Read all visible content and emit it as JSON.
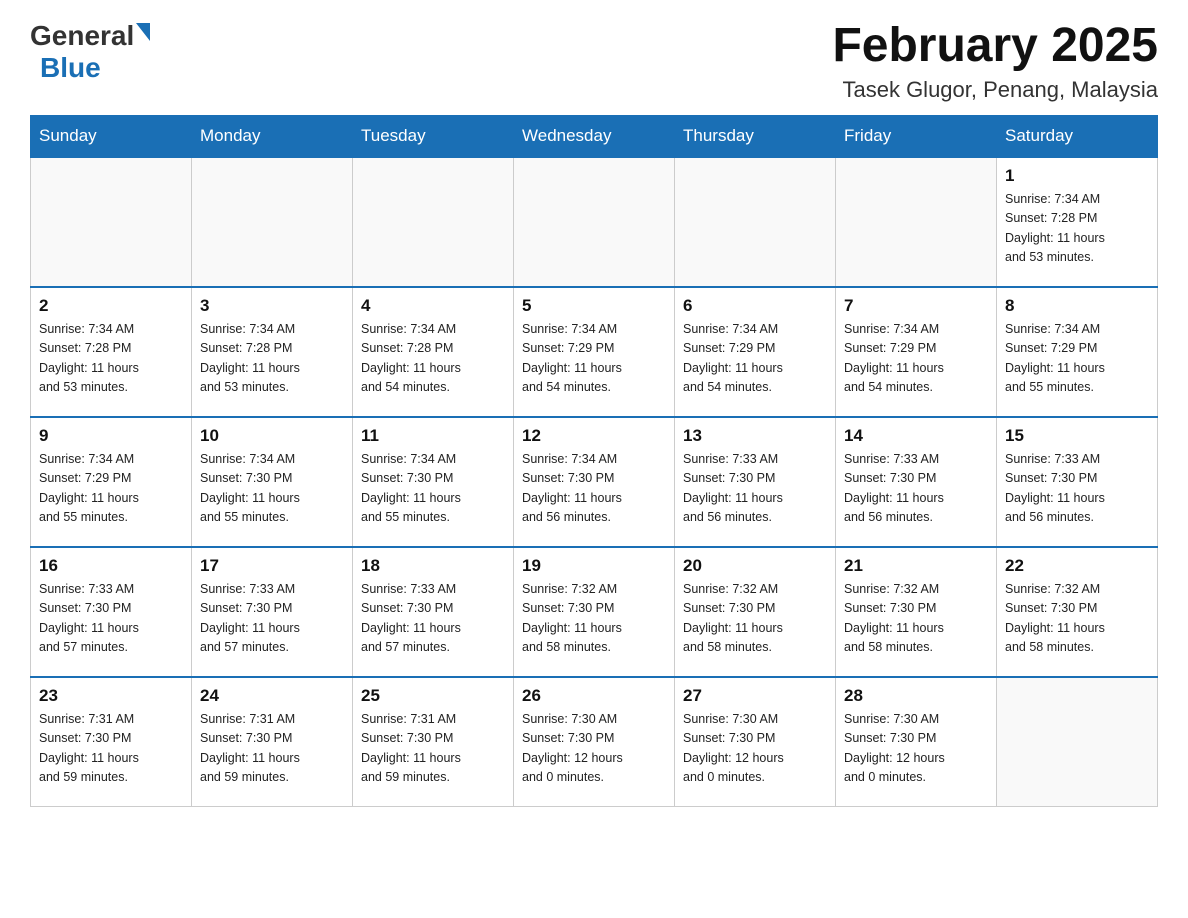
{
  "header": {
    "logo_general": "General",
    "logo_blue": "Blue",
    "title": "February 2025",
    "subtitle": "Tasek Glugor, Penang, Malaysia"
  },
  "weekdays": [
    "Sunday",
    "Monday",
    "Tuesday",
    "Wednesday",
    "Thursday",
    "Friday",
    "Saturday"
  ],
  "weeks": [
    [
      {
        "day": "",
        "info": ""
      },
      {
        "day": "",
        "info": ""
      },
      {
        "day": "",
        "info": ""
      },
      {
        "day": "",
        "info": ""
      },
      {
        "day": "",
        "info": ""
      },
      {
        "day": "",
        "info": ""
      },
      {
        "day": "1",
        "info": "Sunrise: 7:34 AM\nSunset: 7:28 PM\nDaylight: 11 hours\nand 53 minutes."
      }
    ],
    [
      {
        "day": "2",
        "info": "Sunrise: 7:34 AM\nSunset: 7:28 PM\nDaylight: 11 hours\nand 53 minutes."
      },
      {
        "day": "3",
        "info": "Sunrise: 7:34 AM\nSunset: 7:28 PM\nDaylight: 11 hours\nand 53 minutes."
      },
      {
        "day": "4",
        "info": "Sunrise: 7:34 AM\nSunset: 7:28 PM\nDaylight: 11 hours\nand 54 minutes."
      },
      {
        "day": "5",
        "info": "Sunrise: 7:34 AM\nSunset: 7:29 PM\nDaylight: 11 hours\nand 54 minutes."
      },
      {
        "day": "6",
        "info": "Sunrise: 7:34 AM\nSunset: 7:29 PM\nDaylight: 11 hours\nand 54 minutes."
      },
      {
        "day": "7",
        "info": "Sunrise: 7:34 AM\nSunset: 7:29 PM\nDaylight: 11 hours\nand 54 minutes."
      },
      {
        "day": "8",
        "info": "Sunrise: 7:34 AM\nSunset: 7:29 PM\nDaylight: 11 hours\nand 55 minutes."
      }
    ],
    [
      {
        "day": "9",
        "info": "Sunrise: 7:34 AM\nSunset: 7:29 PM\nDaylight: 11 hours\nand 55 minutes."
      },
      {
        "day": "10",
        "info": "Sunrise: 7:34 AM\nSunset: 7:30 PM\nDaylight: 11 hours\nand 55 minutes."
      },
      {
        "day": "11",
        "info": "Sunrise: 7:34 AM\nSunset: 7:30 PM\nDaylight: 11 hours\nand 55 minutes."
      },
      {
        "day": "12",
        "info": "Sunrise: 7:34 AM\nSunset: 7:30 PM\nDaylight: 11 hours\nand 56 minutes."
      },
      {
        "day": "13",
        "info": "Sunrise: 7:33 AM\nSunset: 7:30 PM\nDaylight: 11 hours\nand 56 minutes."
      },
      {
        "day": "14",
        "info": "Sunrise: 7:33 AM\nSunset: 7:30 PM\nDaylight: 11 hours\nand 56 minutes."
      },
      {
        "day": "15",
        "info": "Sunrise: 7:33 AM\nSunset: 7:30 PM\nDaylight: 11 hours\nand 56 minutes."
      }
    ],
    [
      {
        "day": "16",
        "info": "Sunrise: 7:33 AM\nSunset: 7:30 PM\nDaylight: 11 hours\nand 57 minutes."
      },
      {
        "day": "17",
        "info": "Sunrise: 7:33 AM\nSunset: 7:30 PM\nDaylight: 11 hours\nand 57 minutes."
      },
      {
        "day": "18",
        "info": "Sunrise: 7:33 AM\nSunset: 7:30 PM\nDaylight: 11 hours\nand 57 minutes."
      },
      {
        "day": "19",
        "info": "Sunrise: 7:32 AM\nSunset: 7:30 PM\nDaylight: 11 hours\nand 58 minutes."
      },
      {
        "day": "20",
        "info": "Sunrise: 7:32 AM\nSunset: 7:30 PM\nDaylight: 11 hours\nand 58 minutes."
      },
      {
        "day": "21",
        "info": "Sunrise: 7:32 AM\nSunset: 7:30 PM\nDaylight: 11 hours\nand 58 minutes."
      },
      {
        "day": "22",
        "info": "Sunrise: 7:32 AM\nSunset: 7:30 PM\nDaylight: 11 hours\nand 58 minutes."
      }
    ],
    [
      {
        "day": "23",
        "info": "Sunrise: 7:31 AM\nSunset: 7:30 PM\nDaylight: 11 hours\nand 59 minutes."
      },
      {
        "day": "24",
        "info": "Sunrise: 7:31 AM\nSunset: 7:30 PM\nDaylight: 11 hours\nand 59 minutes."
      },
      {
        "day": "25",
        "info": "Sunrise: 7:31 AM\nSunset: 7:30 PM\nDaylight: 11 hours\nand 59 minutes."
      },
      {
        "day": "26",
        "info": "Sunrise: 7:30 AM\nSunset: 7:30 PM\nDaylight: 12 hours\nand 0 minutes."
      },
      {
        "day": "27",
        "info": "Sunrise: 7:30 AM\nSunset: 7:30 PM\nDaylight: 12 hours\nand 0 minutes."
      },
      {
        "day": "28",
        "info": "Sunrise: 7:30 AM\nSunset: 7:30 PM\nDaylight: 12 hours\nand 0 minutes."
      },
      {
        "day": "",
        "info": ""
      }
    ]
  ]
}
